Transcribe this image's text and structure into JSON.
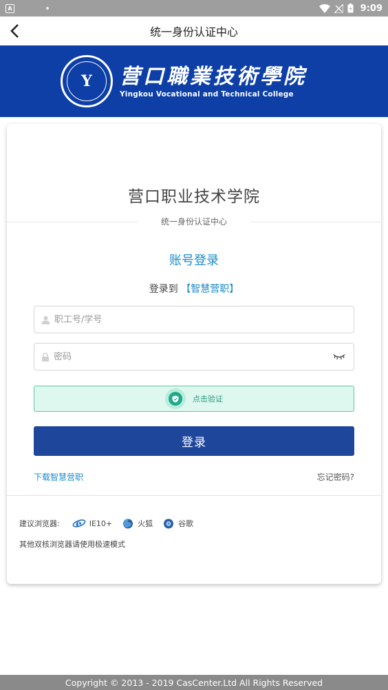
{
  "status_bar": {
    "app_badge": "A",
    "time": "9:09"
  },
  "navbar": {
    "title": "统一身份认证中心"
  },
  "banner": {
    "school_cn": "营口職業技術學院",
    "school_en": "Yingkou Vocational and Technical College",
    "seal_mark": "Y"
  },
  "card": {
    "school_name": "营口职业技术学院",
    "subtitle": "统一身份认证中心",
    "heading": "账号登录",
    "login_to_prefix": "登录到",
    "login_to_target": "【智慧营职】",
    "username_placeholder": "职工号/学号",
    "password_placeholder": "密码",
    "verify_label": "点击验证",
    "login_button": "登录",
    "download_link": "下载智慧营职",
    "forgot_link": "忘记密码?",
    "browsers_label": "建议浏览器:",
    "browsers": [
      "IE10+",
      "火狐",
      "谷歌"
    ],
    "browser_note": "其他双核浏览器请使用极速模式"
  },
  "footer": {
    "copyright": "Copyright © 2013 - 2019 CasCenter.Ltd All Rights Reserved"
  },
  "colors": {
    "banner_bg": "#0d3fa6",
    "accent_link": "#1b8bc9",
    "login_button_bg": "#1e479c",
    "verify_bg": "#def7ef",
    "verify_border": "#56c8a4"
  }
}
